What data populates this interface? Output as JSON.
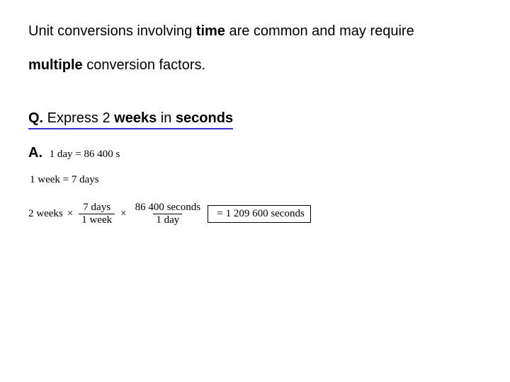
{
  "intro": {
    "pre": "Unit conversions involving ",
    "time": "time",
    "mid": " are common and may require ",
    "mult": "multiple",
    "post": " conversion factors."
  },
  "question": {
    "label": "Q.",
    "pre": " Express 2 ",
    "weeks": "weeks",
    "mid": " in ",
    "seconds": "seconds"
  },
  "answer": {
    "label": "A.",
    "fact1_lhs": "1 day",
    "fact1_eq": "=",
    "fact1_rhs": "86 400 s",
    "fact2_lhs": "1 week",
    "fact2_eq": "=",
    "fact2_rhs": "7 days",
    "calc": {
      "start": "2 weeks",
      "times1": "×",
      "f1_num": "7 days",
      "f1_den": "1 week",
      "times2": "×",
      "f2_num": "86 400 seconds",
      "f2_den": "1 day",
      "eq": "=",
      "result": "1 209 600 seconds"
    }
  }
}
